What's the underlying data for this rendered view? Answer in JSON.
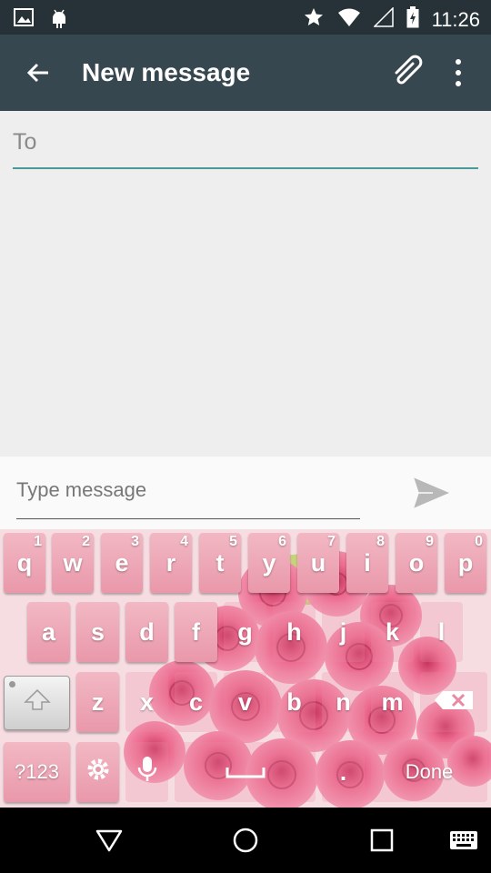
{
  "status_bar": {
    "time": "11:26",
    "left_icons": [
      "image-notification-icon",
      "android-notification-icon"
    ],
    "right_icons": [
      "star-icon",
      "wifi-icon",
      "signal-icon",
      "battery-icon"
    ]
  },
  "toolbar": {
    "title": "New message",
    "back_icon": "arrow-back-icon",
    "attach_icon": "paperclip-icon",
    "more_icon": "more-vert-icon"
  },
  "to_field": {
    "placeholder": "To"
  },
  "compose": {
    "placeholder": "Type message",
    "send_icon": "send-icon"
  },
  "keyboard": {
    "row1": [
      {
        "label": "q",
        "hint": "1"
      },
      {
        "label": "w",
        "hint": "2"
      },
      {
        "label": "e",
        "hint": "3"
      },
      {
        "label": "r",
        "hint": "4"
      },
      {
        "label": "t",
        "hint": "5"
      },
      {
        "label": "y",
        "hint": "6"
      },
      {
        "label": "u",
        "hint": "7"
      },
      {
        "label": "i",
        "hint": "8"
      },
      {
        "label": "o",
        "hint": "9"
      },
      {
        "label": "p",
        "hint": "0"
      }
    ],
    "row2": [
      "a",
      "s",
      "d",
      "f",
      "g",
      "h",
      "j",
      "k",
      "l"
    ],
    "row3": [
      "z",
      "x",
      "c",
      "v",
      "b",
      "n",
      "m"
    ],
    "symbols_label": "?123",
    "period_label": ".",
    "done_label": "Done",
    "colors": {
      "key_top": "#f2b8c4",
      "key_bottom": "#e998aa",
      "rose": "#e8557a"
    }
  },
  "nav_bar": {
    "icons": [
      "back-triangle-icon",
      "home-circle-icon",
      "recents-square-icon",
      "keyboard-switch-icon"
    ]
  }
}
